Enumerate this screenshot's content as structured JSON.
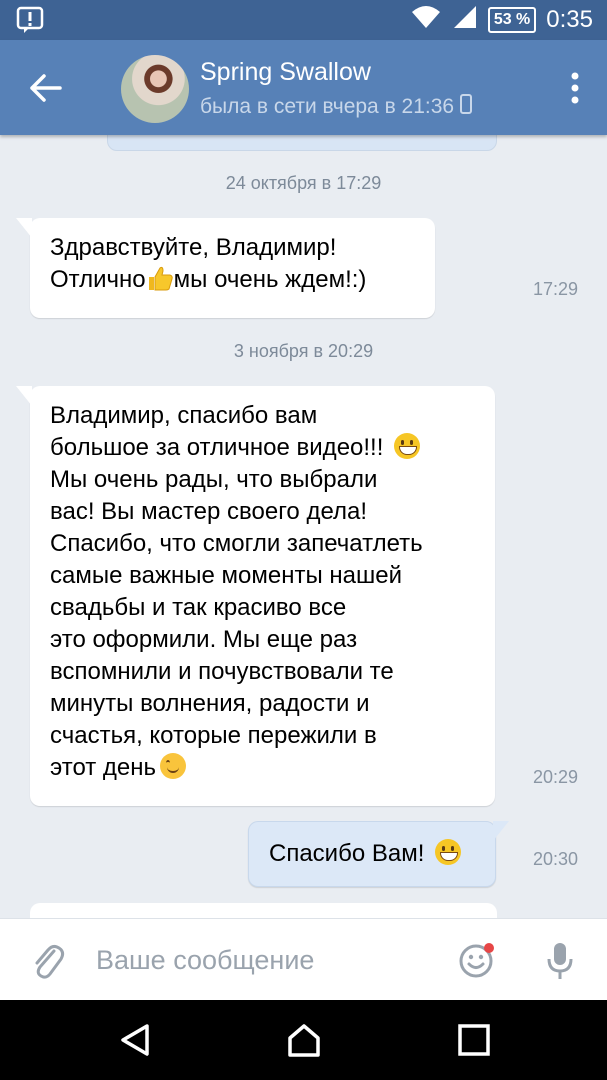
{
  "status_bar": {
    "battery": "53 %",
    "time": "0:35",
    "notification_icon": "alert-notification-icon",
    "wifi_icon": "wifi-icon",
    "signal_icon": "cell-signal-icon"
  },
  "header": {
    "contact_name": "Spring Swallow",
    "last_seen": "была в сети вчера в 21:36",
    "device_icon": "mobile-phone-icon"
  },
  "messages": [
    {
      "type": "date",
      "text": "24 октября в 17:29"
    },
    {
      "type": "incoming",
      "lines": [
        "Здравствуйте, Владимир!",
        "Отлично",
        "мы очень ждем!:)"
      ],
      "time": "17:29"
    },
    {
      "type": "date",
      "text": "3 ноября в 20:29"
    },
    {
      "type": "incoming",
      "lines": [
        "Владимир, спасибо вам",
        "большое за отличное видео!!!",
        "Мы очень рады, что выбрали",
        "вас! Вы мастер своего дела!",
        "Спасибо, что смогли запечатлеть",
        "самые важные моменты нашей",
        "свадьбы и так красиво все",
        "это оформили. Мы еще раз",
        "вспомнили и почувствовали те",
        "минуты волнения, радости и",
        "счастья, которые пережили в",
        "этот день"
      ],
      "time": "20:29"
    },
    {
      "type": "outgoing",
      "text": "Спасибо Вам!",
      "time": "20:30"
    }
  ],
  "input": {
    "placeholder": "Ваше сообщение"
  },
  "colors": {
    "header": "#5781b7",
    "status_bar": "#3e6394",
    "background": "#e9edf2",
    "outgoing_bubble": "#dce8f7"
  }
}
